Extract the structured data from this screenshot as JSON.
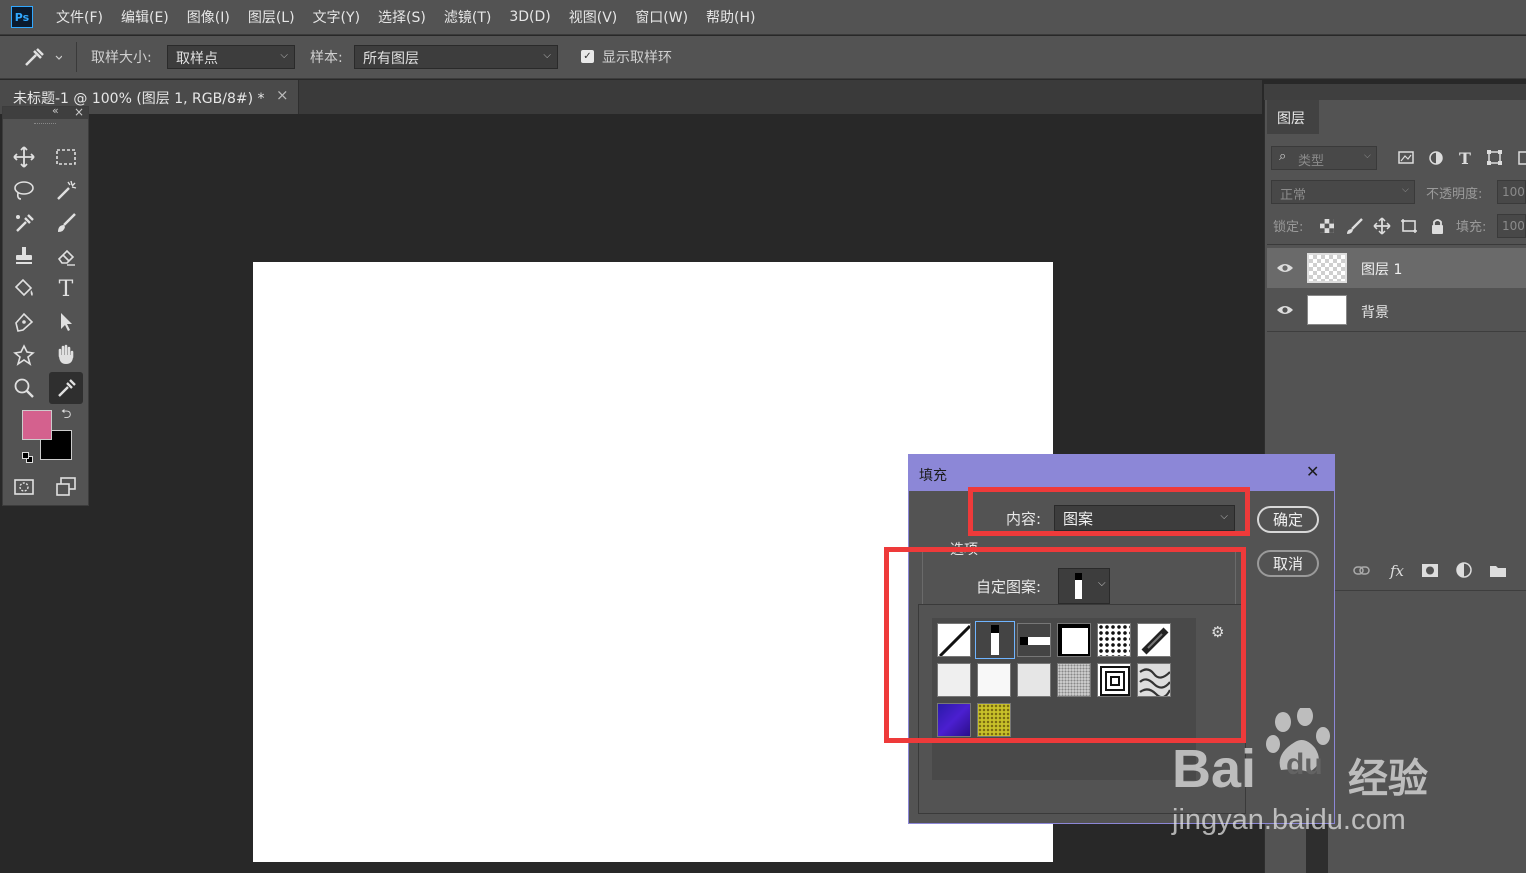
{
  "app": {
    "logo": "Ps"
  },
  "menu": [
    "文件(F)",
    "编辑(E)",
    "图像(I)",
    "图层(L)",
    "文字(Y)",
    "选择(S)",
    "滤镜(T)",
    "3D(D)",
    "视图(V)",
    "窗口(W)",
    "帮助(H)"
  ],
  "options_bar": {
    "tool_icon": "eyedropper-icon",
    "sample_size_label": "取样大小:",
    "sample_size_value": "取样点",
    "sample_label": "样本:",
    "sample_value": "所有图层",
    "show_ring_label": "显示取样环",
    "show_ring_checked": true
  },
  "document_tab": {
    "title": "未标题-1 @ 100% (图层 1, RGB/8#) *",
    "close": "×"
  },
  "toolbar": {
    "collapse": "«",
    "close": "×",
    "tools": [
      "move-tool",
      "marquee-tool",
      "lasso-tool",
      "magic-wand-tool",
      "eyedropper-spot-heal-tool",
      "brush-tool",
      "stamp-tool",
      "eraser-tool",
      "paint-bucket-tool",
      "type-tool",
      "pen-tool",
      "path-select-tool",
      "shape-tool",
      "hand-tool",
      "zoom-tool",
      "eyedropper-tool"
    ],
    "foreground_color": "#d4618e",
    "background_color": "#000000"
  },
  "layers_panel": {
    "tab": "图层",
    "filter_placeholder": "类型",
    "blend_mode": "正常",
    "opacity_label": "不透明度:",
    "opacity_value": "100",
    "lock_label": "锁定:",
    "fill_label": "填充:",
    "fill_value": "100",
    "layers": [
      {
        "name": "图层 1",
        "visible": true,
        "selected": true
      },
      {
        "name": "背景",
        "visible": true,
        "selected": false
      }
    ],
    "fx_label": "fx"
  },
  "fill_dialog": {
    "title": "填充",
    "close": "✕",
    "content_label": "内容:",
    "content_value": "图案",
    "options_label": "选项",
    "custom_pattern_label": "自定图案:",
    "ok": "确定",
    "cancel": "取消",
    "accent_color": "#8c87d7"
  },
  "watermark": {
    "brand": "Bai",
    "brand2": "du",
    "cn": "经验",
    "url": "jingyan.baidu.com"
  }
}
